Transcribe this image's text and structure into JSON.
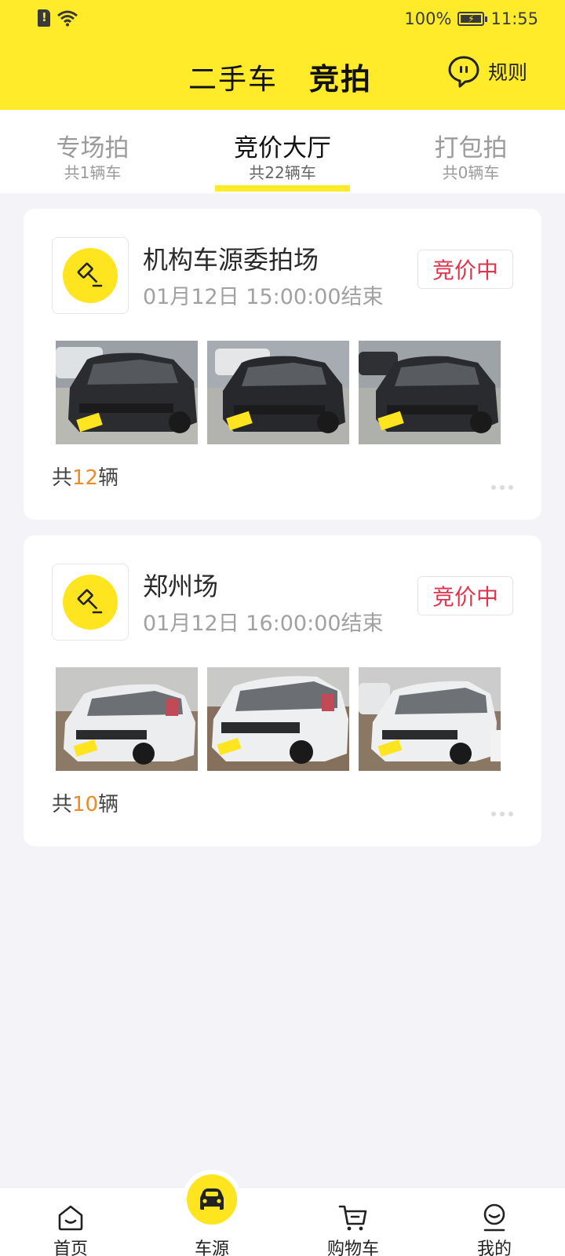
{
  "status_bar": {
    "battery": "100%",
    "time": "11:55"
  },
  "header": {
    "title_used": "二手车",
    "title_auction": "竞拍",
    "rules_label": "规则"
  },
  "tabs": [
    {
      "label": "专场拍",
      "sub": "共1辆车",
      "active": false
    },
    {
      "label": "竞价大厅",
      "sub": "共22辆车",
      "active": true
    },
    {
      "label": "打包拍",
      "sub": "共0辆车",
      "active": false
    }
  ],
  "cards": [
    {
      "title": "机构车源委拍场",
      "time": "01月12日 15:00:00结束",
      "status": "竞价中",
      "count_prefix": "共",
      "count": "12",
      "count_suffix": "辆",
      "photos": [
        "black-sedan-photo",
        "black-sedan-photo",
        "black-sedan-photo"
      ]
    },
    {
      "title": "郑州场",
      "time": "01月12日 16:00:00结束",
      "status": "竞价中",
      "count_prefix": "共",
      "count": "10",
      "count_suffix": "辆",
      "photos": [
        "white-suv-photo",
        "white-suv-photo",
        "white-suv-photo"
      ]
    }
  ],
  "bottom_nav": [
    {
      "label": "首页",
      "icon": "home-icon"
    },
    {
      "label": "车源",
      "icon": "car-icon"
    },
    {
      "label": "购物车",
      "icon": "cart-icon"
    },
    {
      "label": "我的",
      "icon": "profile-icon"
    }
  ],
  "colors": {
    "brand_yellow": "#ffeb2a",
    "status_red": "#e2334c",
    "count_orange": "#f08a24"
  }
}
